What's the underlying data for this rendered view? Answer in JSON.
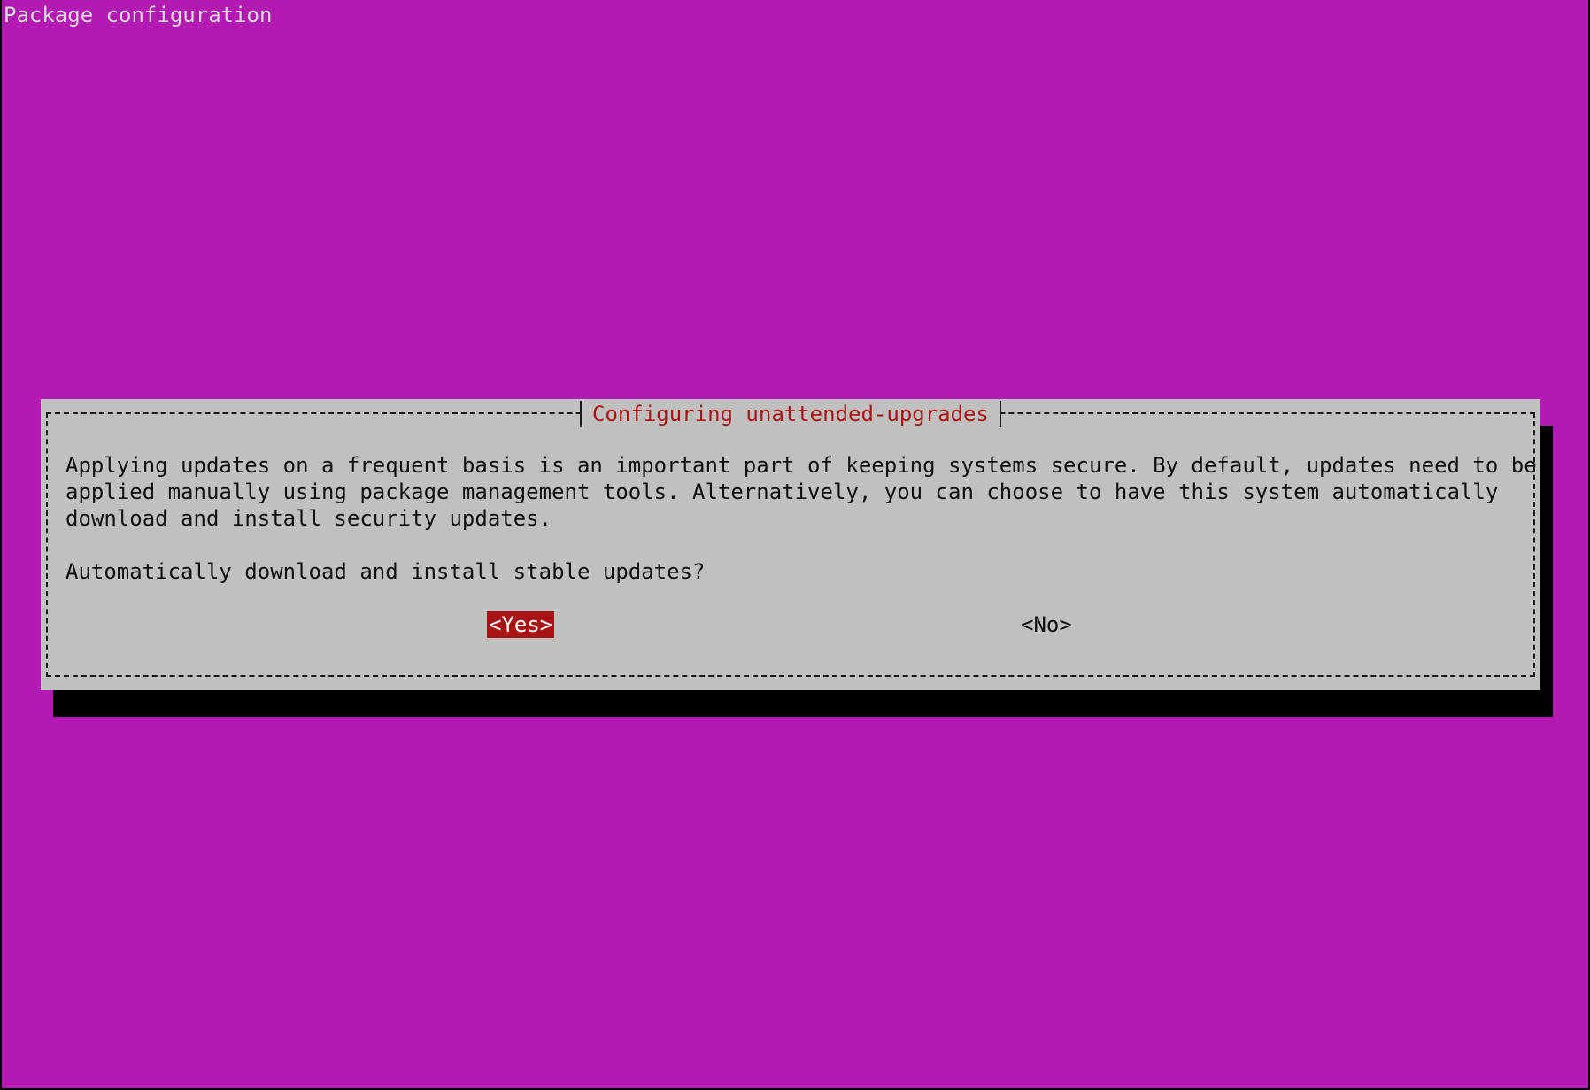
{
  "screen": {
    "title": "Package configuration"
  },
  "dialog": {
    "title": "Configuring unattended-upgrades",
    "description_lines": [
      "Applying updates on a frequent basis is an important part of keeping systems secure. By default, updates need to be",
      "applied manually using package management tools. Alternatively, you can choose to have this system automatically",
      "download and install security updates."
    ],
    "question": "Automatically download and install stable updates?",
    "buttons": {
      "yes": "<Yes>",
      "no": "<No>"
    }
  },
  "colors": {
    "background": "#b21ab2",
    "dialog": "#c0c0c0",
    "accent": "#a81414"
  }
}
